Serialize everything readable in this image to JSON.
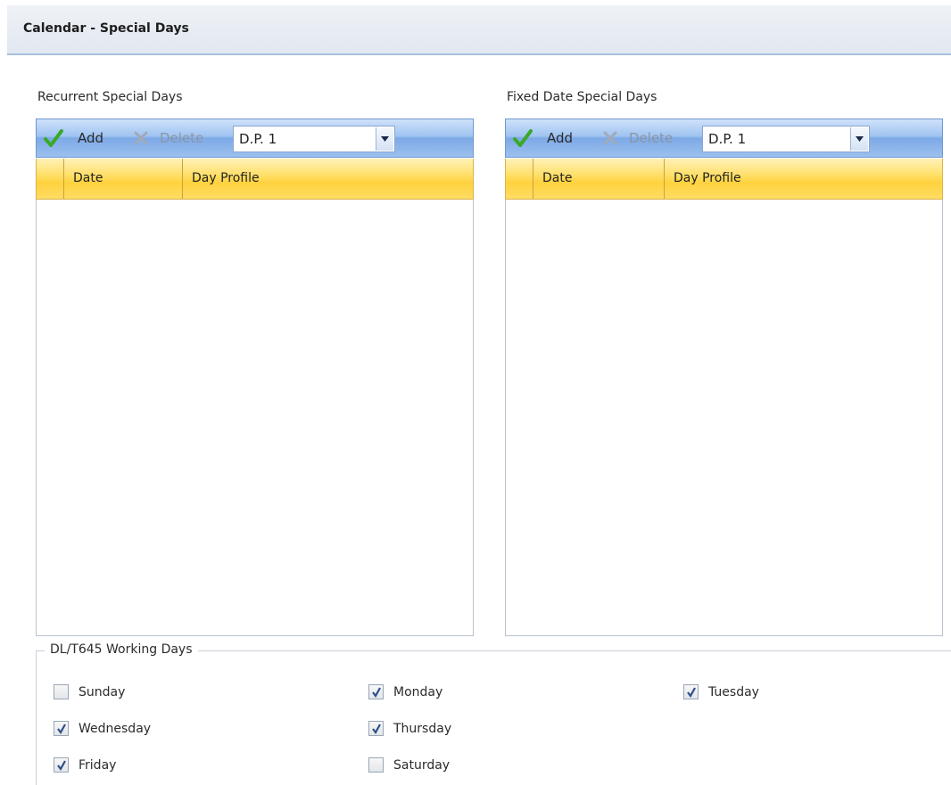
{
  "header": {
    "title": "Calendar - Special Days"
  },
  "recurrent": {
    "label": "Recurrent Special Days",
    "add_label": "Add",
    "delete_label": "Delete",
    "profile_value": "D.P. 1",
    "columns": [
      "Date",
      "Day Profile"
    ]
  },
  "fixed": {
    "label": "Fixed Date Special Days",
    "add_label": "Add",
    "delete_label": "Delete",
    "profile_value": "D.P. 1",
    "columns": [
      "Date",
      "Day Profile"
    ]
  },
  "working_days": {
    "title": "DL/T645 Working Days",
    "days": [
      {
        "label": "Sunday",
        "checked": false
      },
      {
        "label": "Monday",
        "checked": true
      },
      {
        "label": "Tuesday",
        "checked": true
      },
      {
        "label": "Wednesday",
        "checked": true
      },
      {
        "label": "Thursday",
        "checked": true
      },
      {
        "label": "Friday",
        "checked": true
      },
      {
        "label": "Saturday",
        "checked": false
      }
    ]
  },
  "colors": {
    "check_green": "#3aa829",
    "grid_header": "#ffd23f",
    "toolbar": "#9fc3f0"
  }
}
